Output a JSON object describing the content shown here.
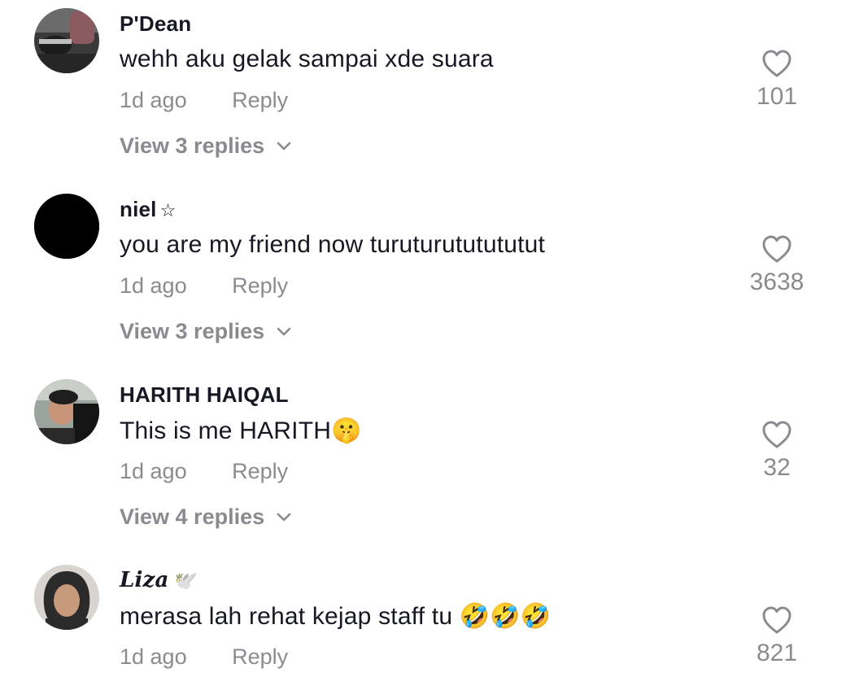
{
  "comments": [
    {
      "username": "P'Dean",
      "username_deco": "",
      "text": "wehh aku gelak sampai xde suara",
      "time": "1d ago",
      "reply_label": "Reply",
      "view_replies": "View 3 replies",
      "likes": "101",
      "avatar_icon": "car-interior-photo-avatar"
    },
    {
      "username": "niel",
      "username_deco": "☆",
      "text": "you are my friend now turuturututututut",
      "time": "1d ago",
      "reply_label": "Reply",
      "view_replies": "View 3 replies",
      "likes": "3638",
      "avatar_icon": "black-circle-avatar"
    },
    {
      "username": "HARITH HAIQAL",
      "username_deco": "",
      "text": "This is me HARITH🤫",
      "time": "1d ago",
      "reply_label": "Reply",
      "view_replies": "View 4 replies",
      "likes": "32",
      "avatar_icon": "person-photo-avatar"
    },
    {
      "username": "Liza",
      "username_deco": "🕊️",
      "text": "merasa lah rehat kejap staff tu 🤣🤣🤣",
      "time": "1d ago",
      "reply_label": "Reply",
      "view_replies": "",
      "likes": "821",
      "avatar_icon": "hijab-person-photo-avatar"
    }
  ],
  "colors": {
    "primary_text": "#161823",
    "secondary_text": "#8a8b91",
    "background": "#ffffff"
  }
}
